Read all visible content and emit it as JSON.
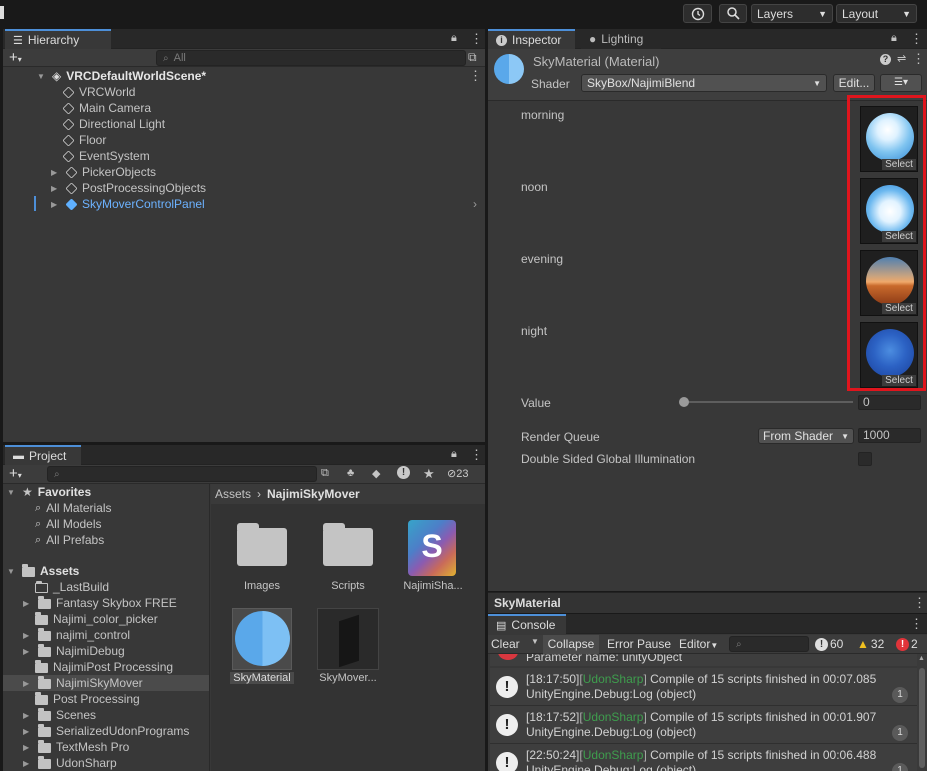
{
  "toolbar": {
    "layers_label": "Layers",
    "layout_label": "Layout"
  },
  "hierarchy": {
    "tab_label": "Hierarchy",
    "search_placeholder": "All",
    "scene_name": "VRCDefaultWorldScene*",
    "items": [
      {
        "label": "VRCWorld"
      },
      {
        "label": "Main Camera"
      },
      {
        "label": "Directional Light"
      },
      {
        "label": "Floor"
      },
      {
        "label": "EventSystem"
      },
      {
        "label": "PickerObjects"
      },
      {
        "label": "PostProcessingObjects"
      },
      {
        "label": "SkyMoverControlPanel"
      }
    ]
  },
  "project": {
    "tab_label": "Project",
    "hidden_count": "23",
    "favorites_label": "Favorites",
    "favorites": [
      "All Materials",
      "All Models",
      "All Prefabs"
    ],
    "assets_label": "Assets",
    "folders": [
      "_LastBuild",
      "Fantasy Skybox FREE",
      "Najimi_color_picker",
      "najimi_control",
      "NajimiDebug",
      "NajimiPost Processing",
      "NajimiSkyMover",
      "Post Processing",
      "Scenes",
      "SerializedUdonPrograms",
      "TextMesh Pro",
      "UdonSharp"
    ],
    "breadcrumb_root": "Assets",
    "breadcrumb_current": "NajimiSkyMover",
    "grid_items": [
      "Images",
      "Scripts",
      "NajimiSha...",
      "SkyMaterial",
      "SkyMover..."
    ],
    "script_letter": "S"
  },
  "inspector": {
    "tab_label": "Inspector",
    "lighting_tab_label": "Lighting",
    "material_title": "SkyMaterial (Material)",
    "shader_label": "Shader",
    "shader_value": "SkyBox/NajimiBlend",
    "edit_label": "Edit...",
    "textures": [
      {
        "label": "morning",
        "select": "Select"
      },
      {
        "label": "noon",
        "select": "Select"
      },
      {
        "label": "evening",
        "select": "Select"
      },
      {
        "label": "night",
        "select": "Select"
      }
    ],
    "value_label": "Value",
    "value": "0",
    "slider_fraction": 0,
    "render_queue_label": "Render Queue",
    "render_queue_mode": "From Shader",
    "render_queue_value": "1000",
    "dsgi_label": "Double Sided Global Illumination",
    "preview_label": "SkyMaterial",
    "highlight_color": "#e0151d"
  },
  "console": {
    "tab_label": "Console",
    "clear_label": "Clear",
    "collapse_label": "Collapse",
    "error_pause_label": "Error Pause",
    "editor_label": "Editor",
    "info_count": "60",
    "warn_count": "32",
    "error_count": "2",
    "partial_line": "Parameter name: unityObject",
    "entries": [
      {
        "time": "[18:17:50]",
        "tag": "UdonSharp",
        "msg": " Compile of 15 scripts finished in 00:07.085",
        "sub": "UnityEngine.Debug:Log (object)",
        "count": "1"
      },
      {
        "time": "[18:17:52]",
        "tag": "UdonSharp",
        "msg": " Compile of 15 scripts finished in 00:01.907",
        "sub": "UnityEngine.Debug:Log (object)",
        "count": "1"
      },
      {
        "time": "[22:50:24]",
        "tag": "UdonSharp",
        "msg": " Compile of 15 scripts finished in 00:06.488",
        "sub": "UnityEngine.Debug:Log (object)",
        "count": "1"
      }
    ]
  }
}
